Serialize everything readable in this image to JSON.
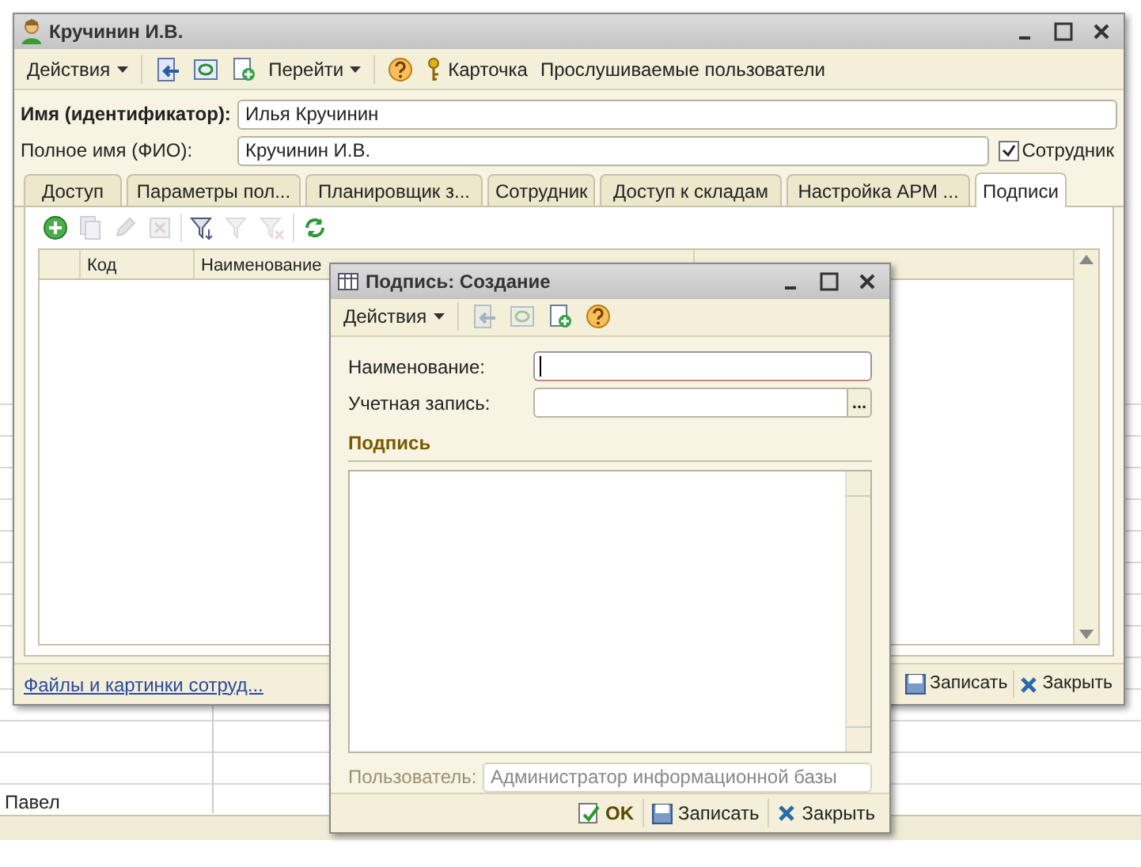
{
  "background_list": {
    "rows": [
      {
        "name": "Павел"
      }
    ]
  },
  "main_window": {
    "title": "Кручинин И.В.",
    "toolbar": [
      {
        "kind": "menu",
        "label": "Действия"
      },
      {
        "kind": "icon",
        "disabled": false
      },
      {
        "kind": "icon",
        "disabled": false
      },
      {
        "kind": "icon",
        "disabled": false
      },
      {
        "kind": "menu",
        "label": "Перейти"
      },
      {
        "kind": "icon",
        "disabled": false
      },
      {
        "kind": "button",
        "label": "Карточка"
      },
      {
        "kind": "button",
        "label": "Прослушиваемые пользователи"
      }
    ],
    "fields": [
      {
        "label": "Имя (идентификатор):",
        "value": "Илья Кручинин",
        "bold": true
      },
      {
        "label": "Полное имя (ФИО):",
        "value": "Кручинин И.В.",
        "bold": false
      }
    ],
    "employee_checkbox": {
      "label": "Сотрудник",
      "checked": true
    },
    "tabs": [
      {
        "label": "Доступ",
        "selected": false
      },
      {
        "label": "Параметры пол...",
        "selected": false
      },
      {
        "label": "Планировщик з...",
        "selected": false
      },
      {
        "label": "Сотрудник",
        "selected": false
      },
      {
        "label": "Доступ к складам",
        "selected": false
      },
      {
        "label": "Настройка АРМ ...",
        "selected": false
      },
      {
        "label": "Подписи",
        "selected": true
      }
    ],
    "table_toolbar": [
      {
        "disabled": false
      },
      {
        "disabled": true
      },
      {
        "disabled": true
      },
      {
        "disabled": true
      },
      {
        "disabled": false
      },
      {
        "disabled": true
      },
      {
        "disabled": true
      },
      {
        "disabled": false
      }
    ],
    "table": {
      "columns": [
        "Код",
        "Наименование"
      ]
    },
    "link": "Файлы и картинки сотруд...",
    "buttons": [
      "Записать",
      "Закрыть"
    ]
  },
  "dialog": {
    "title": "Подпись: Создание",
    "toolbar": [
      {
        "kind": "menu",
        "label": "Действия"
      },
      {
        "kind": "icon",
        "disabled": true
      },
      {
        "kind": "icon",
        "disabled": true
      },
      {
        "kind": "icon",
        "disabled": false
      },
      {
        "kind": "icon",
        "disabled": false
      }
    ],
    "fields": [
      {
        "label": "Наименование:",
        "focused": true
      },
      {
        "label": "Учетная запись:",
        "focused": false,
        "select_button": "..."
      }
    ],
    "section": "Подпись",
    "user": {
      "label": "Пользователь:",
      "value": "Администратор информационной базы",
      "disabled": true
    },
    "buttons": [
      {
        "kind": "ok",
        "label": "OK"
      },
      {
        "kind": "save",
        "label": "Записать"
      },
      {
        "kind": "close",
        "label": "Закрыть"
      }
    ]
  }
}
